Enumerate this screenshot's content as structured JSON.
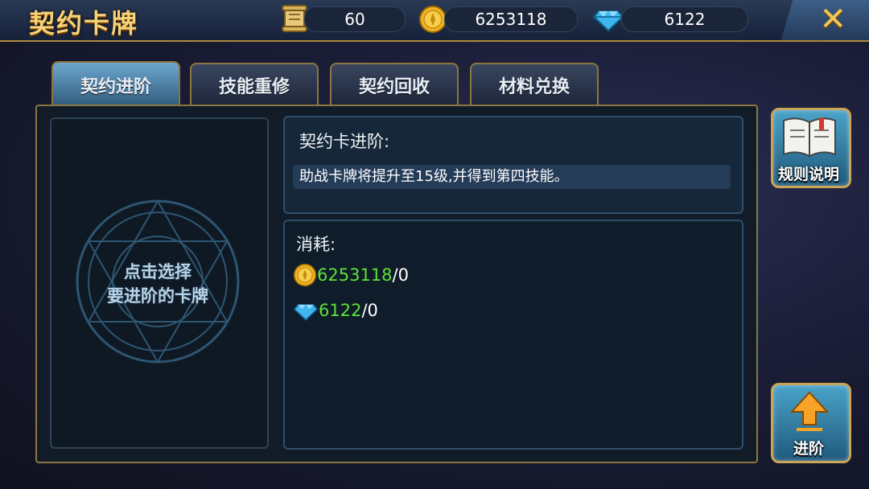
{
  "header": {
    "title": "契约卡牌"
  },
  "resources": {
    "scroll": {
      "value": "60",
      "icon": "scroll-icon"
    },
    "gold": {
      "value": "6253118",
      "icon": "gold-coin-icon"
    },
    "diamond": {
      "value": "6122",
      "icon": "diamond-icon"
    }
  },
  "tabs": [
    {
      "label": "契约进阶",
      "active": true
    },
    {
      "label": "技能重修",
      "active": false
    },
    {
      "label": "契约回收",
      "active": false
    },
    {
      "label": "材料兑换",
      "active": false
    }
  ],
  "card_slot": {
    "line1": "点击选择",
    "line2": "要进阶的卡牌"
  },
  "description": {
    "heading": "契约卡进阶:",
    "text": "助战卡牌将提升至15级,并得到第四技能。"
  },
  "cost": {
    "heading": "消耗:",
    "gold_have": "6253118",
    "gold_need": "/0",
    "diamond_have": "6122",
    "diamond_need": "/0"
  },
  "buttons": {
    "rules_label": "规则说明",
    "advance_label": "进阶"
  },
  "colors": {
    "accent_gold": "#f6d27a",
    "frame": "#8c7640",
    "sufficient_green": "#5fe03a"
  }
}
